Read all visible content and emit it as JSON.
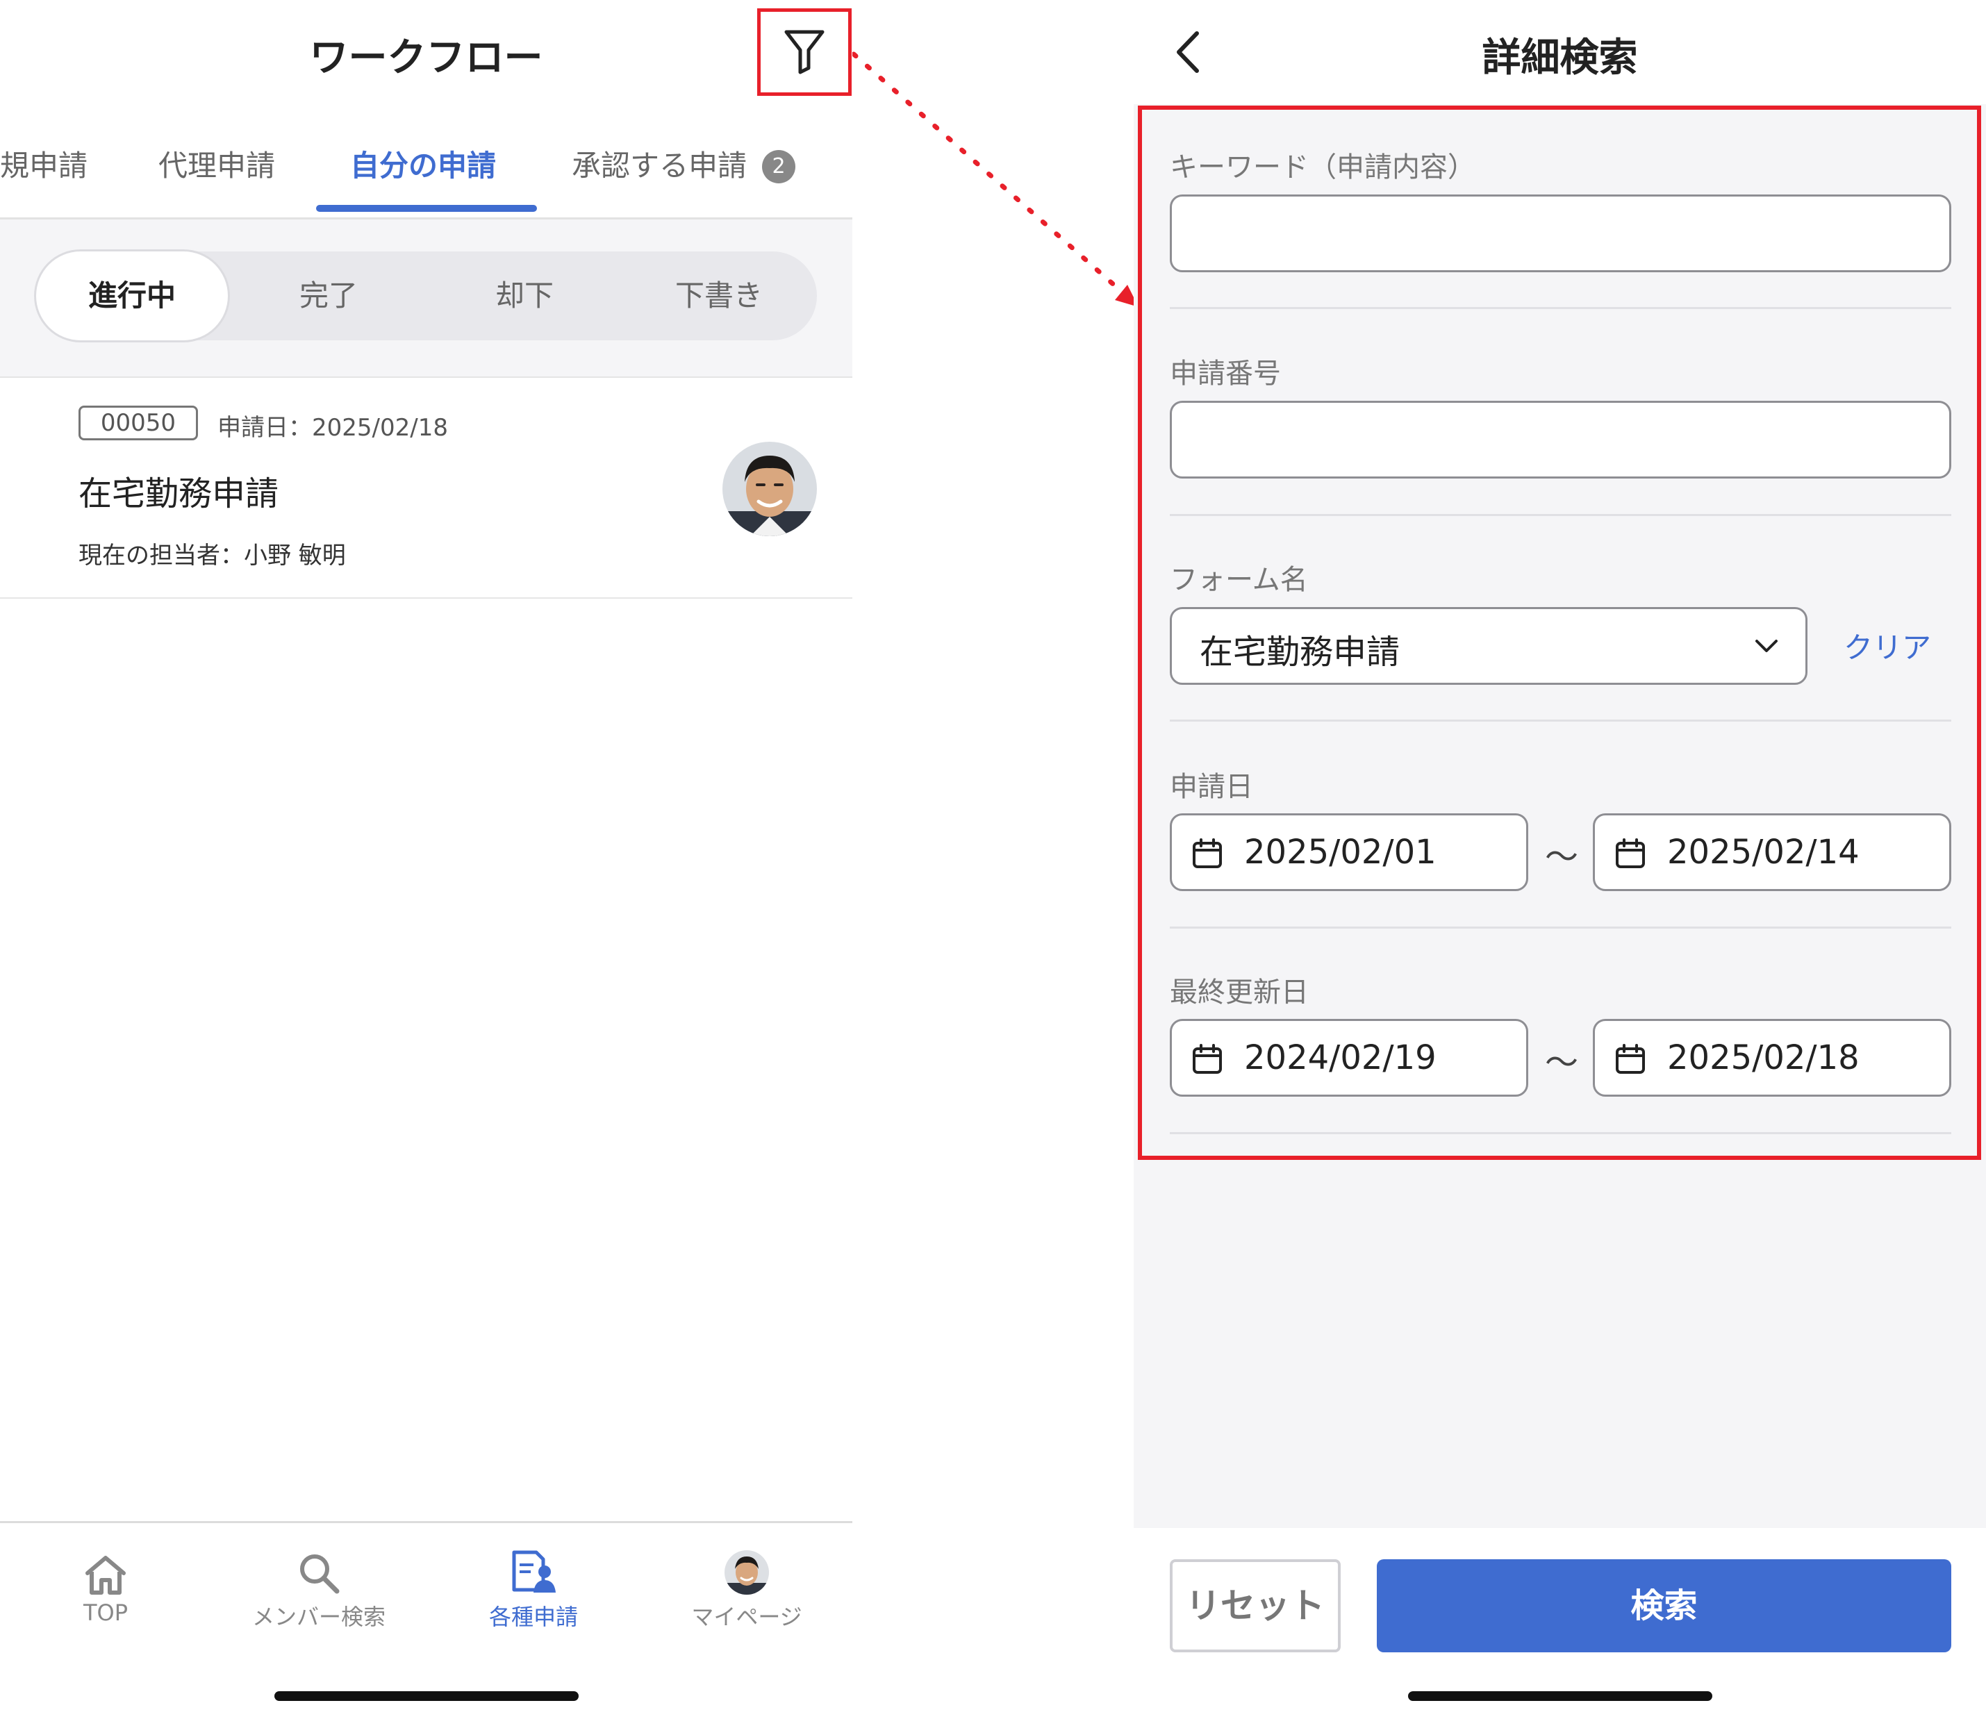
{
  "left_screen": {
    "header": {
      "title": "ワークフロー"
    },
    "tabs": [
      {
        "label": "規申請"
      },
      {
        "label": "代理申請"
      },
      {
        "label": "自分の申請"
      },
      {
        "label": "承認する申請",
        "badge": "2"
      }
    ],
    "segments": [
      "進行中",
      "完了",
      "却下",
      "下書き"
    ],
    "request": {
      "number": "00050",
      "apply_date": "申請日：2025/02/18",
      "title": "在宅勤務申請",
      "assignee": "現在の担当者：小野 敏明"
    },
    "bottom_nav": [
      {
        "label": "TOP",
        "icon": "home-icon"
      },
      {
        "label": "メンバー検索",
        "icon": "search-icon"
      },
      {
        "label": "各種申請",
        "icon": "application-form-icon"
      },
      {
        "label": "マイページ",
        "icon": "avatar-icon"
      }
    ]
  },
  "right_screen": {
    "header": {
      "title": "詳細検索"
    },
    "fields": {
      "keyword": {
        "label": "キーワード（申請内容）",
        "value": ""
      },
      "request_number": {
        "label": "申請番号",
        "value": ""
      },
      "form_name": {
        "label": "フォーム名",
        "value": "在宅勤務申請",
        "clear_label": "クリア"
      },
      "apply_date": {
        "label": "申請日",
        "from": "2025/02/01",
        "separator": "〜",
        "to": "2025/02/14"
      },
      "last_updated": {
        "label": "最終更新日",
        "from": "2024/02/19",
        "separator": "〜",
        "to": "2025/02/18"
      }
    },
    "buttons": {
      "reset": "リセット",
      "search": "検索"
    }
  },
  "colors": {
    "accent": "#3f6cd0",
    "highlight": "#e8202a",
    "form_background": "#f5f5f7"
  }
}
